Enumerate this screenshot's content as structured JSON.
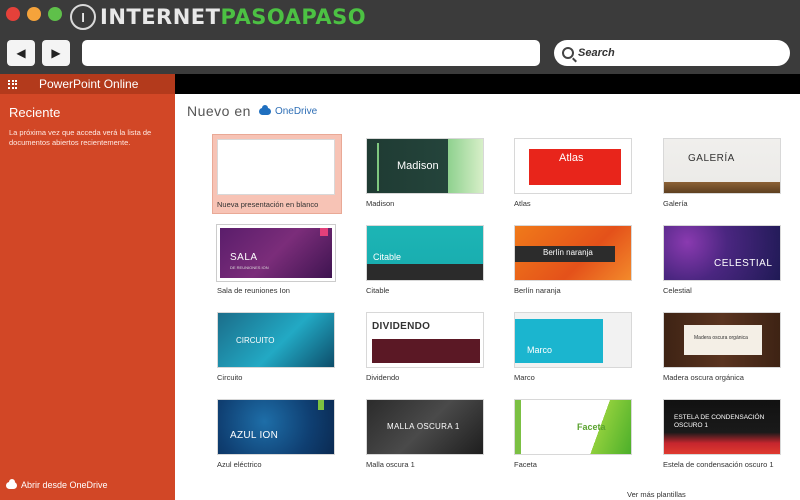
{
  "browser": {
    "logo_mark": "I",
    "logo_text_white": "INTERNET",
    "logo_text_green": "PASOAPASO",
    "back_icon": "back-arrow-icon",
    "forward_icon": "forward-arrow-icon",
    "url_value": "",
    "search_placeholder": "Search"
  },
  "sidebar": {
    "app_title": "PowerPoint Online",
    "heading": "Reciente",
    "description": "La próxima vez que acceda verá la lista de documentos abiertos recientemente.",
    "footer_link": "Abrir desde OneDrive",
    "color": "#d24726"
  },
  "main": {
    "nuevo_label": "Nuevo en",
    "onedrive_label": "OneDrive",
    "more_templates": "Ver más plantillas",
    "templates": [
      {
        "label": "Nueva presentación en blanco",
        "title": ""
      },
      {
        "label": "Madison",
        "title": "Madison"
      },
      {
        "label": "Atlas",
        "title": "Atlas"
      },
      {
        "label": "Galería",
        "title": "GALERÍA"
      },
      {
        "label": "Sala de reuniones Ion",
        "title": "SALA",
        "subtitle": "DE REUNIONES ION"
      },
      {
        "label": "Citable",
        "title": "Citable"
      },
      {
        "label": "Berlín naranja",
        "title": "Berlín naranja"
      },
      {
        "label": "Celestial",
        "title": "CELESTIAL"
      },
      {
        "label": "Circuito",
        "title": "CIRCUITO"
      },
      {
        "label": "Dividendo",
        "title": "DIVIDENDO"
      },
      {
        "label": "Marco",
        "title": "Marco"
      },
      {
        "label": "Madera oscura orgánica",
        "title": "Madera oscura orgánica"
      },
      {
        "label": "Azul eléctrico",
        "title": "AZUL ION"
      },
      {
        "label": "Malla oscura 1",
        "title": "MALLA OSCURA 1"
      },
      {
        "label": "Faceta",
        "title": "Faceta"
      },
      {
        "label": "Estela de condensación oscuro 1",
        "title": "ESTELA DE CONDENSACIÓN OSCURO 1"
      }
    ]
  }
}
